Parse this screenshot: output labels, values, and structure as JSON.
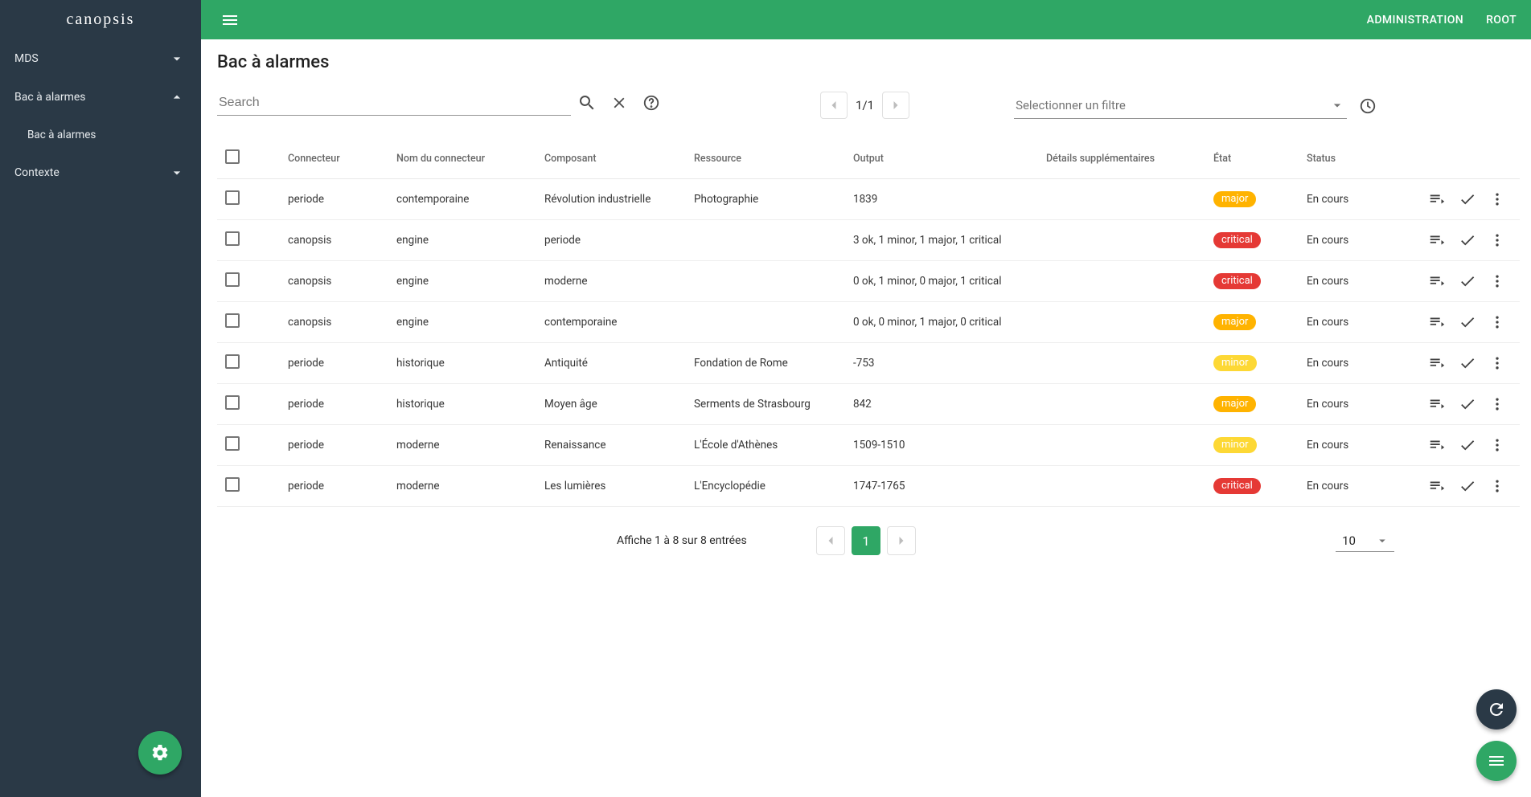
{
  "brand": "canopsis",
  "header": {
    "admin": "ADMINISTRATION",
    "root": "ROOT"
  },
  "sidebar": {
    "items": [
      {
        "label": "MDS",
        "expanded": false,
        "hasChildren": true
      },
      {
        "label": "Bac à alarmes",
        "expanded": true,
        "hasChildren": true
      },
      {
        "label": "Bac à alarmes",
        "child": true
      },
      {
        "label": "Contexte",
        "expanded": false,
        "hasChildren": true
      }
    ]
  },
  "page": {
    "title": "Bac à alarmes"
  },
  "search": {
    "placeholder": "Search"
  },
  "pager_top": {
    "text": "1/1"
  },
  "filter": {
    "placeholder": "Selectionner un filtre"
  },
  "columns": {
    "connecteur": "Connecteur",
    "nom_connecteur": "Nom du connecteur",
    "composant": "Composant",
    "ressource": "Ressource",
    "output": "Output",
    "details": "Détails supplémentaires",
    "etat": "État",
    "status": "Status"
  },
  "rows": [
    {
      "connecteur": "periode",
      "nom": "contemporaine",
      "composant": "Révolution industrielle",
      "ressource": "Photographie",
      "output": "1839",
      "details": "",
      "etat": "major",
      "status": "En cours"
    },
    {
      "connecteur": "canopsis",
      "nom": "engine",
      "composant": "periode",
      "ressource": "",
      "output": "3 ok, 1 minor, 1 major, 1 critical",
      "details": "",
      "etat": "critical",
      "status": "En cours"
    },
    {
      "connecteur": "canopsis",
      "nom": "engine",
      "composant": "moderne",
      "ressource": "",
      "output": "0 ok, 1 minor, 0 major, 1 critical",
      "details": "",
      "etat": "critical",
      "status": "En cours"
    },
    {
      "connecteur": "canopsis",
      "nom": "engine",
      "composant": "contemporaine",
      "ressource": "",
      "output": "0 ok, 0 minor, 1 major, 0 critical",
      "details": "",
      "etat": "major",
      "status": "En cours"
    },
    {
      "connecteur": "periode",
      "nom": "historique",
      "composant": "Antiquité",
      "ressource": "Fondation de Rome",
      "output": "-753",
      "details": "",
      "etat": "minor",
      "status": "En cours"
    },
    {
      "connecteur": "periode",
      "nom": "historique",
      "composant": "Moyen âge",
      "ressource": "Serments de Strasbourg",
      "output": "842",
      "details": "",
      "etat": "major",
      "status": "En cours"
    },
    {
      "connecteur": "periode",
      "nom": "moderne",
      "composant": "Renaissance",
      "ressource": "L'École d'Athènes",
      "output": "1509-1510",
      "details": "",
      "etat": "minor",
      "status": "En cours"
    },
    {
      "connecteur": "periode",
      "nom": "moderne",
      "composant": "Les lumières",
      "ressource": "L'Encyclopédie",
      "output": "1747-1765",
      "details": "",
      "etat": "critical",
      "status": "En cours"
    }
  ],
  "footer": {
    "info": "Affiche 1 à 8 sur 8 entrées",
    "active_page": "1",
    "page_size": "10"
  }
}
